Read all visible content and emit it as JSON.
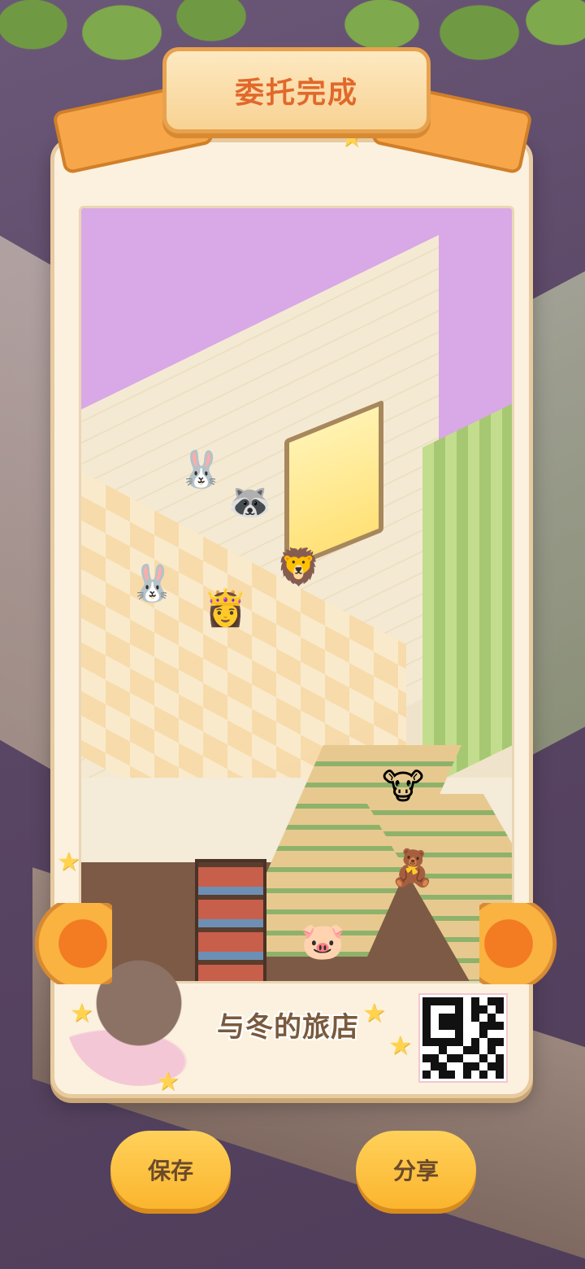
{
  "banner": {
    "title": "委托完成"
  },
  "footer": {
    "logo": "与冬的旅店"
  },
  "buttons": {
    "save": "保存",
    "share": "分享"
  },
  "colors": {
    "banner_text": "#e1682b",
    "button_bg": "#fbb52e",
    "button_text": "#6b4a2b",
    "card_bg": "#fbf1de",
    "background": "#5b4766"
  },
  "icons": [
    "star-icon",
    "horn-icon",
    "qr-code",
    "sheep-mascot"
  ]
}
